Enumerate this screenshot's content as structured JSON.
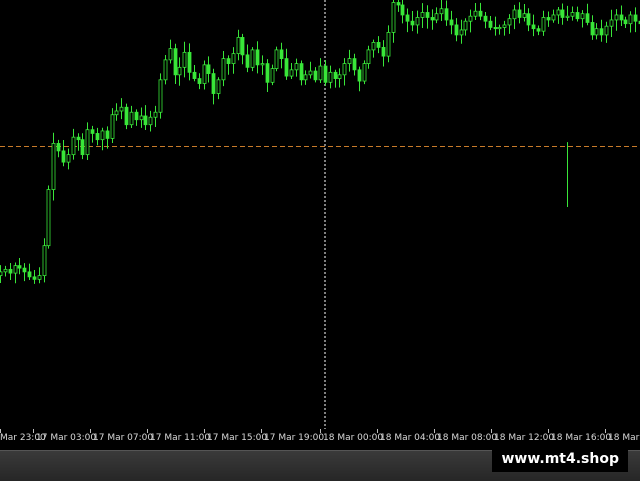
{
  "chart": {
    "bull_color": "#39e639",
    "bear_color": "#39e639",
    "background": "#000000",
    "level_line_color": "#c87b2a",
    "level_price": 0.9575,
    "session_separator_label": "18 Mar 00:00"
  },
  "chart_data": {
    "type": "candlestick",
    "ylim": [
      0.9348,
      0.9692
    ],
    "y": [
      0.9474,
      0.9476,
      0.9473,
      0.9479,
      0.9477,
      0.9474,
      0.947,
      0.9468,
      0.9471,
      0.9495,
      0.954,
      0.9577,
      0.9571,
      0.9562,
      0.9568,
      0.9582,
      0.958,
      0.9568,
      0.9588,
      0.9585,
      0.958,
      0.9587,
      0.9581,
      0.96,
      0.9603,
      0.9606,
      0.9592,
      0.9602,
      0.9596,
      0.9599,
      0.9592,
      0.9598,
      0.9602,
      0.9628,
      0.9644,
      0.9653,
      0.9632,
      0.9638,
      0.965,
      0.9634,
      0.9629,
      0.9625,
      0.964,
      0.9633,
      0.9617,
      0.9628,
      0.9645,
      0.9641,
      0.9649,
      0.9662,
      0.9648,
      0.9638,
      0.9652,
      0.964,
      0.9641,
      0.9626,
      0.9637,
      0.9652,
      0.9645,
      0.9631,
      0.9636,
      0.9641,
      0.9628,
      0.9632,
      0.9635,
      0.9628,
      0.9639,
      0.9626,
      0.9634,
      0.9629,
      0.9632,
      0.9641,
      0.9645,
      0.9636,
      0.9627,
      0.9641,
      0.9652,
      0.9658,
      0.9654,
      0.9647,
      0.9666,
      0.969,
      0.9688,
      0.968,
      0.9675,
      0.9672,
      0.9678,
      0.9682,
      0.9678,
      0.9676,
      0.9681,
      0.9685,
      0.9676,
      0.9672,
      0.9664,
      0.9668,
      0.9675,
      0.9679,
      0.9683,
      0.9679,
      0.9675,
      0.967,
      0.9669,
      0.967,
      0.9672,
      0.9677,
      0.9684,
      0.9678,
      0.9681,
      0.9672,
      0.9669,
      0.9667,
      0.9678,
      0.9676,
      0.968,
      0.9684,
      0.9678,
      0.9679,
      0.9682,
      0.9677,
      0.9681,
      0.9674,
      0.9664,
      0.9669,
      0.9664,
      0.9671,
      0.9676,
      0.968,
      0.9676,
      0.9673,
      0.968,
      0.9675,
      0.9673
    ]
  },
  "time_axis": {
    "labels": [
      "Mar 23:00",
      "17 Mar 03:00",
      "17 Mar 07:00",
      "17 Mar 11:00",
      "17 Mar 15:00",
      "17 Mar 19:00",
      "18 Mar 00:00",
      "18 Mar 04:00",
      "18 Mar 08:00",
      "18 Mar 12:00",
      "18 Mar 16:00",
      "18 Mar"
    ]
  },
  "watermark": {
    "text": "www.mt4.shop"
  }
}
